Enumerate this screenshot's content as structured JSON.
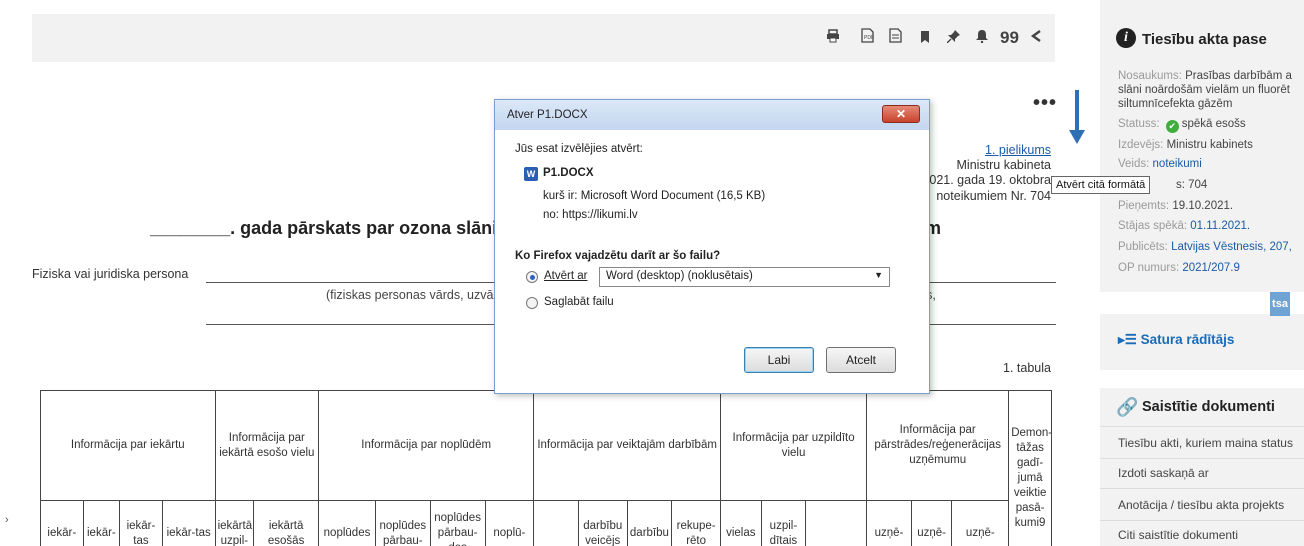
{
  "document": {
    "toolbar_icons": [
      "print-icon",
      "pdf-icon",
      "document-icon",
      "bookmark-icon",
      "pin-icon",
      "bell-icon",
      "quote-icon",
      "share-icon"
    ],
    "more": "•••",
    "attachment": {
      "link": "1. pielikums",
      "line1": "Ministru kabineta",
      "line2": "2021. gada 19. oktobra",
      "line3": "noteikumiem Nr. 704"
    },
    "title_start": "________. gada pārskats par ozona slāni n",
    "title_end": "ēm",
    "person_label": "Fiziska vai juridiska persona",
    "hint_left": "(fiziskas personas vārds, uzvār",
    "hint_right": "urs,",
    "table_label": "1. tabula",
    "table": {
      "group_headers": [
        "Informācija par iekārtu",
        "Informācija par iekārtā esošo vielu",
        "Informācija par noplūdēm",
        "Informācija par veiktajām darbībām",
        "Informācija par uzpildīto vielu",
        "Informācija par pārstrādes/reģenerācijas uzņēmumu",
        "Demon-tāžas gadī-jumā veiktie pasā-kumi9"
      ],
      "sub_headers": [
        "iekār-",
        "iekār-",
        "iekār-tas",
        "iekār-tas",
        "iekārtā uzpil-",
        "iekārtā esošās",
        "noplūdes",
        "noplūdes pārbau-",
        "noplūdes pārbau-des",
        "noplū-",
        "",
        "darbību veicējs",
        "darbību",
        "rekupe-rēto",
        "vielas",
        "uzpil-dītais",
        "",
        "",
        "uzņē-",
        "uzņē-",
        "uzņē-",
        ""
      ]
    },
    "left_edge": "›"
  },
  "sidebar": {
    "pass_title": "Tiesību akta pase",
    "rows": [
      {
        "label": "Nosaukums: ",
        "value": "Prasības darbībām a"
      },
      {
        "label": "",
        "value": "slāni noārdošām vielām un fluorēt"
      },
      {
        "label": "",
        "value": "siltumnīcefekta gāzēm"
      },
      {
        "label": "Statuss: ",
        "value": "spēkā esošs"
      },
      {
        "label": "Izdevējs: ",
        "value": "Ministru kabinets"
      },
      {
        "label": "Veids: ",
        "value": "noteikumi"
      },
      {
        "label": "",
        "value": "s: 704"
      },
      {
        "label": "Pieņemts: ",
        "value": "19.10.2021."
      },
      {
        "label": "Stājas spēkā: ",
        "value": "01.11.2021."
      },
      {
        "label": "Publicēts: ",
        "value": "Latvijas Vēstnesis, 207,"
      },
      {
        "label": "OP numurs: ",
        "value": "2021/207.9"
      }
    ],
    "tsa": "tsa",
    "toc_label": "Satura rādītājs",
    "links_title": "Saistītie dokumenti",
    "links": [
      "Tiesību akti, kuriem maina status",
      "Izdoti saskaņā ar",
      "Anotācija / tiesību akta projekts",
      "Citi saistītie dokumenti"
    ],
    "tooltip": "Atvērt citā formātā"
  },
  "dialog": {
    "title": "Atver P1.DOCX",
    "close": "✕",
    "intro": "Jūs esat izvēlējies atvērt:",
    "filename": "P1.DOCX",
    "kind": "kurš ir:  Microsoft Word Document (16,5 KB)",
    "from": "no:  https://likumi.lv",
    "question": "Ko Firefox vajadzētu darīt ar šo failu?",
    "open_with_label": "Atvērt ar",
    "open_with_value": "Word (desktop) (noklusētais)",
    "save_label": "Saglabāt failu",
    "ok": "Labi",
    "cancel": "Atcelt"
  }
}
